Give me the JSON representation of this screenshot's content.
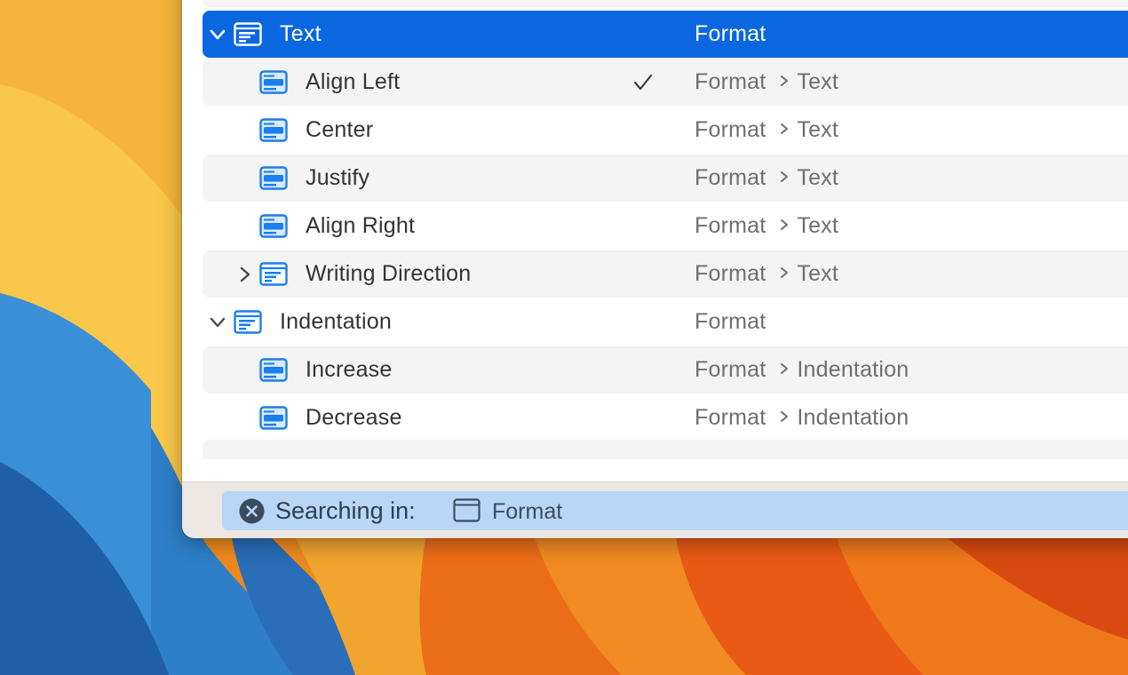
{
  "colors": {
    "selection": "#0a67e0",
    "icon_blue": "#1a7df0",
    "scope_bar": "#b9d6f6"
  },
  "icons": {
    "expand": "chevron-down-icon",
    "collapse": "chevron-right-icon",
    "menu": "menu-item-icon",
    "check": "checkmark-icon",
    "breadcrumb": "chevron-right-icon",
    "clear_scope": "close-circle-icon",
    "scope": "window-icon"
  },
  "rows": [
    {
      "label": "Text",
      "path": "Format",
      "path_sub": "",
      "selected": true,
      "enabled": true,
      "disclosure": "expanded"
    },
    {
      "label": "Align Left",
      "path": "Format",
      "path_sub": "Text",
      "checked": true,
      "enabled": true
    },
    {
      "label": "Center",
      "path": "Format",
      "path_sub": "Text",
      "enabled": true
    },
    {
      "label": "Justify",
      "path": "Format",
      "path_sub": "Text",
      "enabled": true
    },
    {
      "label": "Align Right",
      "path": "Format",
      "path_sub": "Text",
      "enabled": true
    },
    {
      "label": "Writing Direction",
      "path": "Format",
      "path_sub": "Text",
      "enabled": true,
      "disclosure": "collapsed"
    },
    {
      "label": "Indentation",
      "path": "Format",
      "path_sub": "",
      "enabled": true,
      "disclosure": "expanded"
    },
    {
      "label": "Increase",
      "path": "Format",
      "path_sub": "Indentation",
      "enabled": false
    },
    {
      "label": "Decrease",
      "path": "Format",
      "path_sub": "Indentation",
      "enabled": false
    }
  ],
  "scope": {
    "label": "Searching in:",
    "menu": "Format"
  }
}
